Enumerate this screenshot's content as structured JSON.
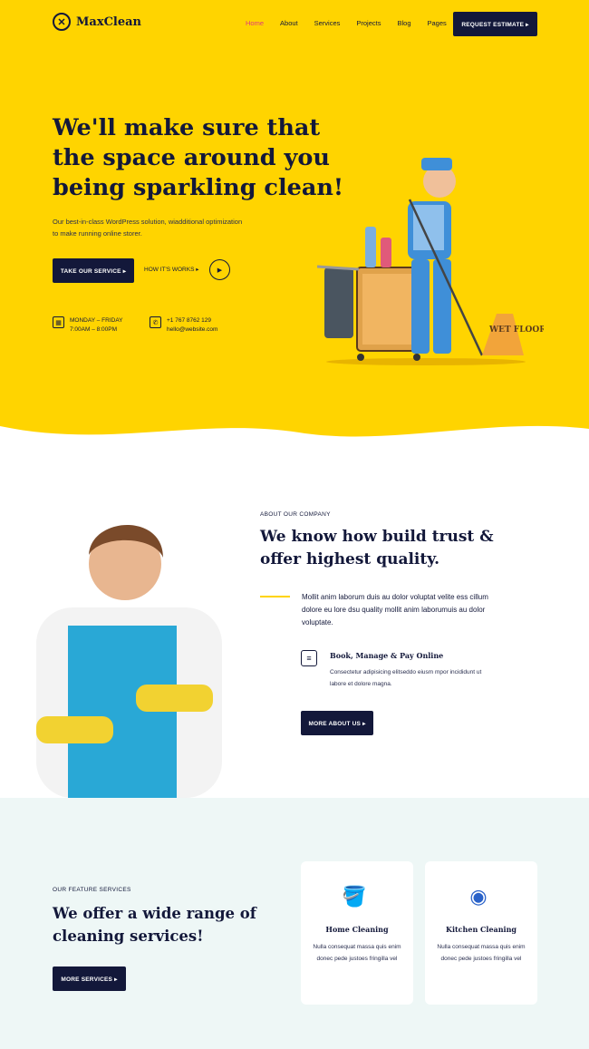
{
  "brand": {
    "name": "MaxClean",
    "icon": "logo-icon"
  },
  "nav": {
    "items": [
      "Home",
      "About",
      "Services",
      "Projects",
      "Blog",
      "Pages"
    ],
    "cta": "REQUEST ESTIMATE ▸"
  },
  "hero": {
    "title": "We'll make sure that the space around you being sparkling clean!",
    "subtitle": "Our best-in-class WordPress solution, wiadditional optimization to make running online storer.",
    "primary_button": "TAKE OUR SERVICE ▸",
    "secondary_link": "HOW IT'S WORKS ▸",
    "hours_label": "MONDAY – FRIDAY",
    "hours_time": "7:00AM – 8:00PM",
    "phone": "+1 767 8762 129",
    "email": "hello@website.com",
    "sign_text": "WET FLOOR"
  },
  "about": {
    "tag": "ABOUT OUR COMPANY",
    "title": "We know how build trust & offer highest quality.",
    "text": "Mollit anim laborum duis au dolor voluptat velite ess cillum dolore eu lore dsu quality mollit anim laborumuis au dolor voluptate.",
    "feature_title": "Book, Manage & Pay Online",
    "feature_text": "Consectetur adipisicing elitseddo eiusm mpor incididunt ut labore et dolore magna.",
    "button": "MORE ABOUT US ▸"
  },
  "services": {
    "tag": "OUR FEATURE SERVICES",
    "title": "We offer a wide range of cleaning services!",
    "button": "MORE SERVICES ▸",
    "cards": [
      {
        "title": "Home Cleaning",
        "text": "Nulla consequat massa quis enim donec pede justoes fringilla vel",
        "icon": "bucket-icon"
      },
      {
        "title": "Kitchen Cleaning",
        "text": "Nulla consequat massa quis enim donec pede justoes fringilla vel",
        "icon": "dish-icon"
      }
    ]
  },
  "colors": {
    "accent": "#ffd400",
    "dark": "#13183a",
    "active": "#e0397b",
    "service_bg": "#eef7f6"
  }
}
